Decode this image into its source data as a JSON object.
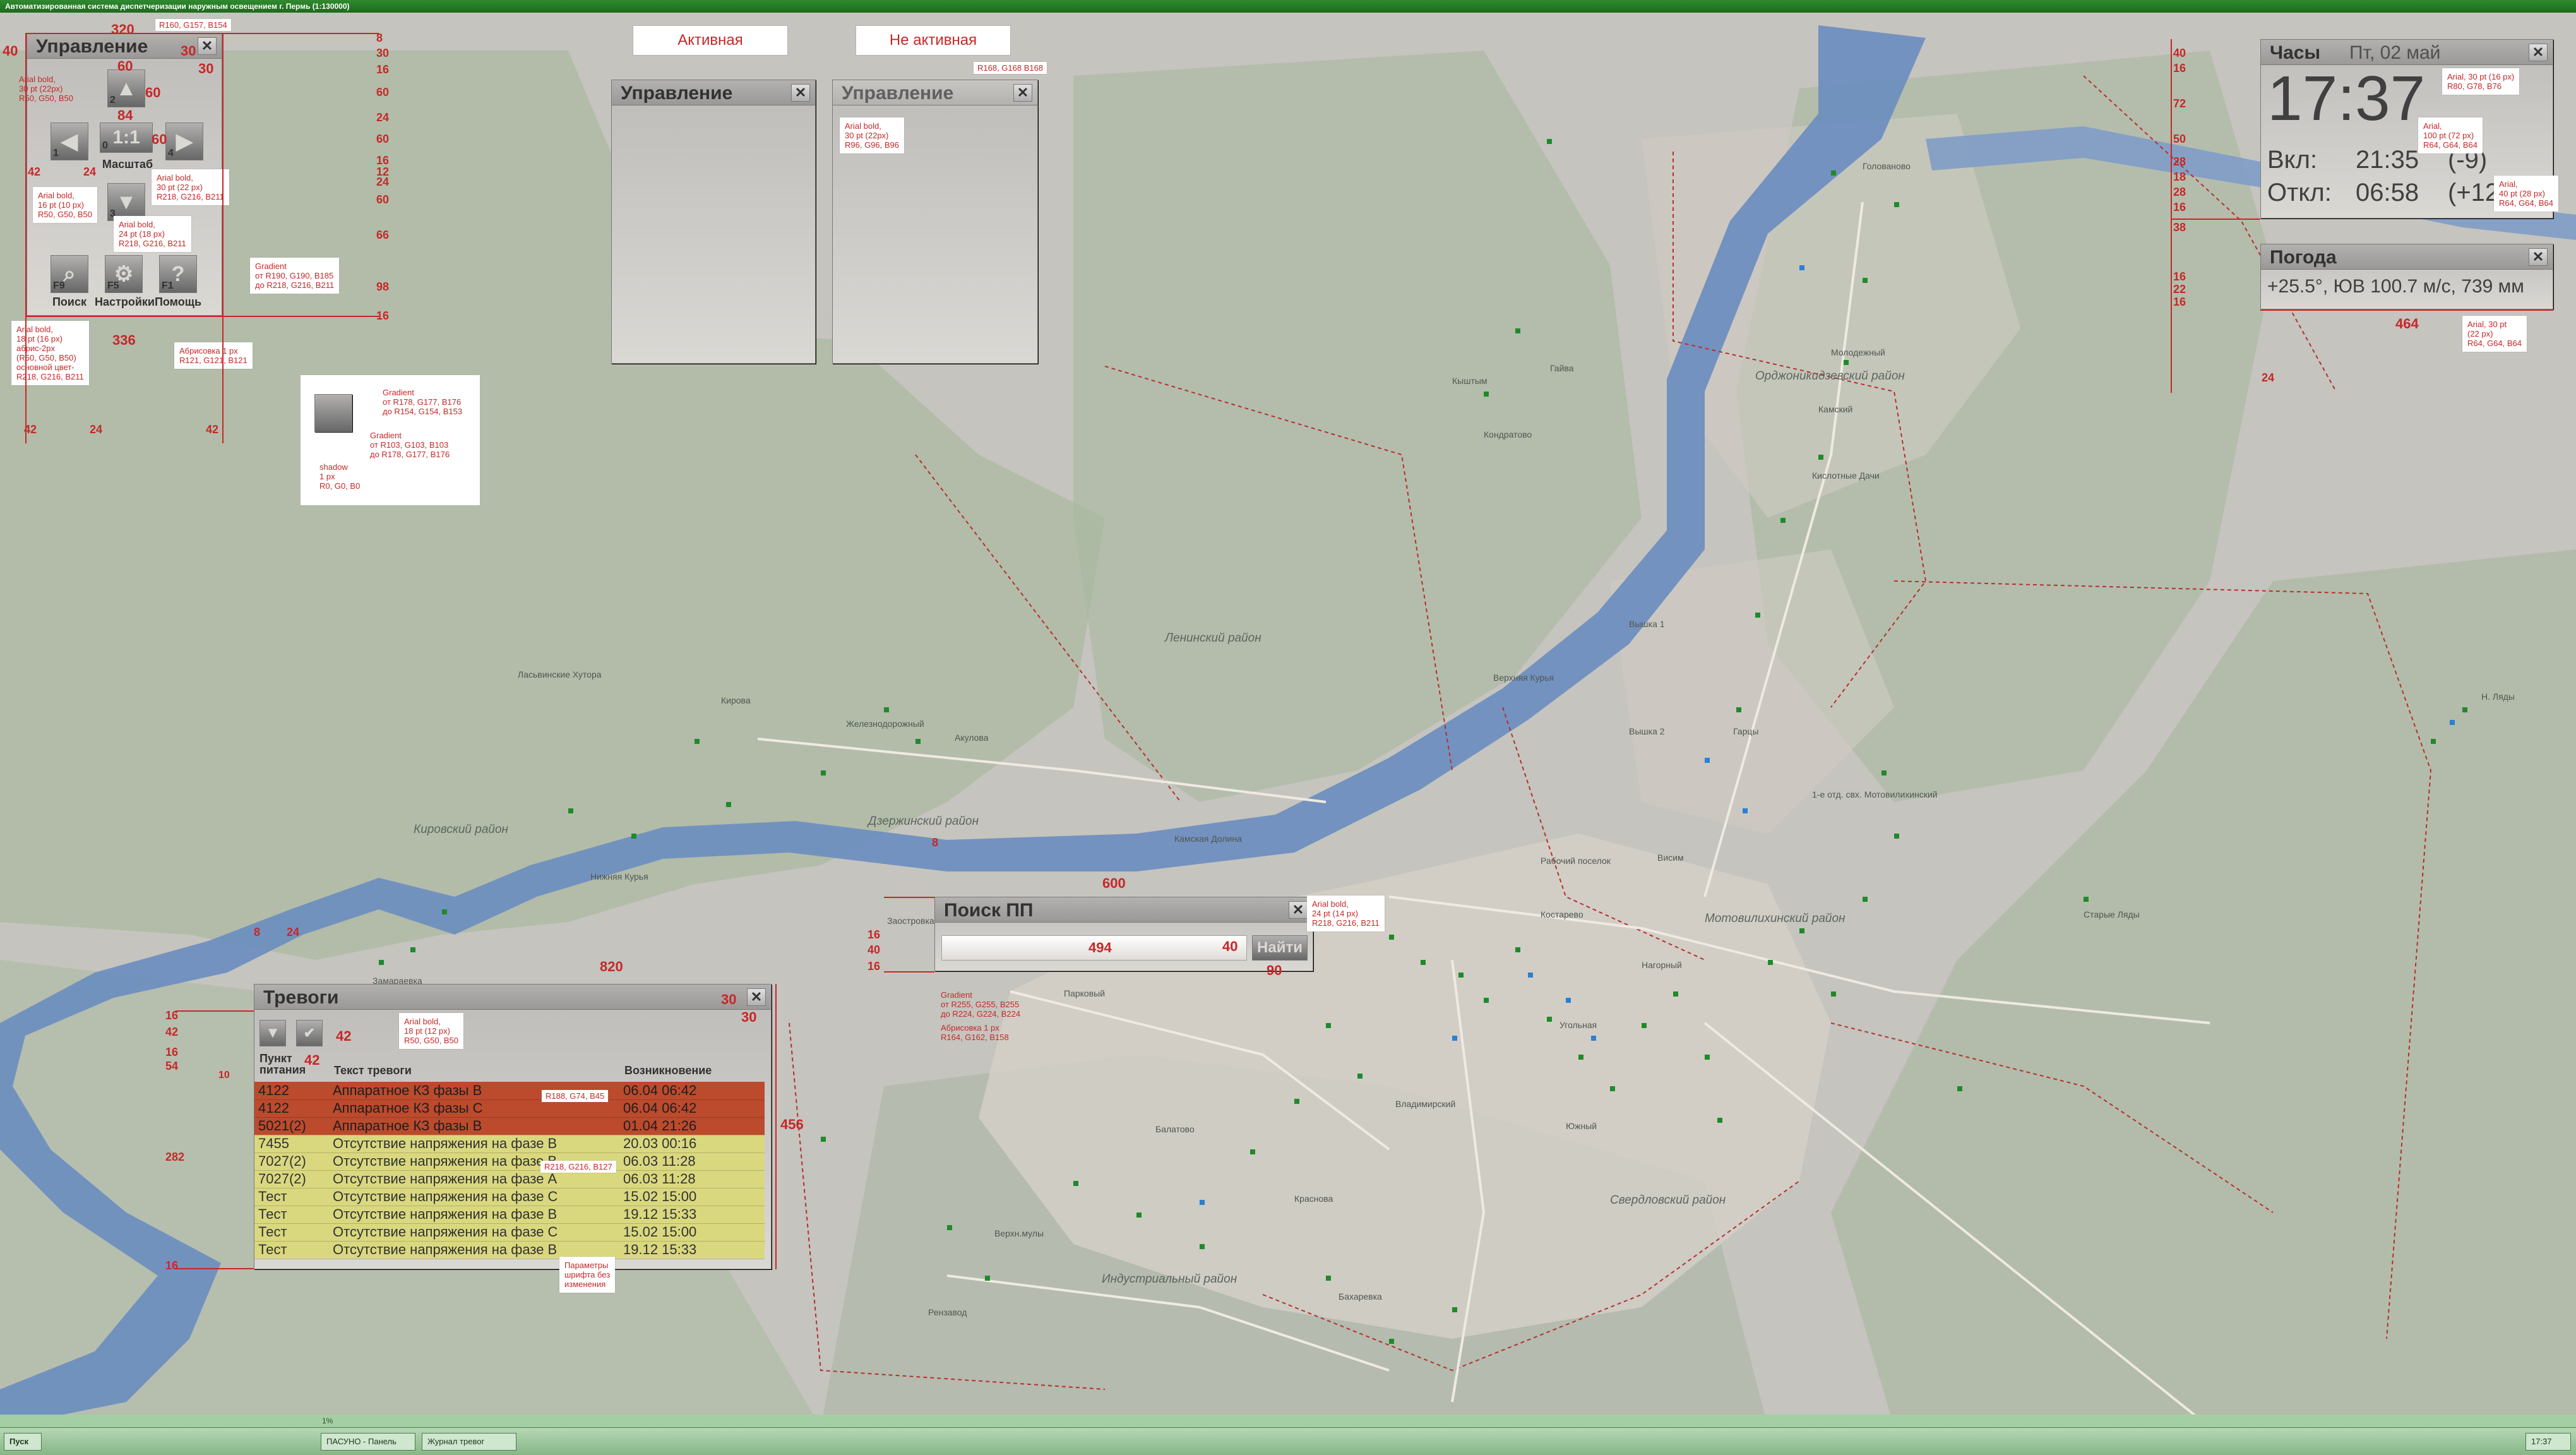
{
  "window": {
    "title": "Автоматизированная система диспетчеризации наружным освещением г. Пермь (1:130000)"
  },
  "colors": {
    "accent": "#c62828",
    "panel_text": "#323232",
    "alarm_red": "#bc4a2d",
    "alarm_yellow": "#dad87f"
  },
  "states": {
    "active": "Активная",
    "inactive": "Не активная"
  },
  "control": {
    "title": "Управление",
    "zoom_label": "Масштаб",
    "zoom_ratio": "1:1",
    "buttons": [
      {
        "name": "search",
        "label": "Поиск",
        "key": "F9",
        "icon": "magnifier-icon"
      },
      {
        "name": "settings",
        "label": "Настройки",
        "key": "F5",
        "icon": "gear-icon"
      },
      {
        "name": "help",
        "label": "Помощь",
        "key": "F1",
        "icon": "question-icon"
      }
    ],
    "arrow_keys": [
      "1",
      "2",
      "3",
      "4",
      "0"
    ]
  },
  "control_active": {
    "title": "Управление"
  },
  "control_inactive": {
    "title": "Управление"
  },
  "clock": {
    "title": "Часы",
    "date": "Пт, 02 май",
    "time": "17:37",
    "on_label": "Вкл:",
    "on_time": "21:35",
    "on_offset": "(-9)",
    "off_label": "Откл:",
    "off_time": "06:58",
    "off_offset": "(+12)"
  },
  "weather": {
    "title": "Погода",
    "text": "+25.5°, ЮВ 100.7 м/с, 739 мм"
  },
  "search": {
    "title": "Поиск ПП",
    "value": "",
    "button": "Найти"
  },
  "alarms": {
    "title": "Тревоги",
    "columns": [
      "Пункт питания",
      "Текст тревоги",
      "Возникновение"
    ],
    "rows": [
      {
        "point": "4122",
        "text": "Аппаратное КЗ фазы В",
        "time": "06.04 06:42",
        "level": "red"
      },
      {
        "point": "4122",
        "text": "Аппаратное КЗ фазы С",
        "time": "06.04 06:42",
        "level": "red"
      },
      {
        "point": "5021(2)",
        "text": "Аппаратное КЗ фазы В",
        "time": "01.04 21:26",
        "level": "red"
      },
      {
        "point": "7455",
        "text": "Отсутствие напряжения на фазе В",
        "time": "20.03 00:16",
        "level": "yellow"
      },
      {
        "point": "7027(2)",
        "text": "Отсутствие напряжения на фазе В",
        "time": "06.03 11:28",
        "level": "yellow"
      },
      {
        "point": "7027(2)",
        "text": "Отсутствие напряжения на фазе А",
        "time": "06.03 11:28",
        "level": "yellow"
      },
      {
        "point": "Тест",
        "text": "Отсутствие напряжения на фазе С",
        "time": "15.02 15:00",
        "level": "yellow"
      },
      {
        "point": "Тест",
        "text": "Отсутствие напряжения на фазе В",
        "time": "19.12 15:33",
        "level": "yellow"
      },
      {
        "point": "Тест",
        "text": "Отсутствие напряжения на фазе С",
        "time": "15.02 15:00",
        "level": "yellow"
      },
      {
        "point": "Тест",
        "text": "Отсутствие напряжения на фазе В",
        "time": "19.12 15:33",
        "level": "yellow"
      }
    ]
  },
  "map_labels": {
    "leninsky": "Ленинский район",
    "dzerzhinsky": "Дзержинский район",
    "kirovsky": "Кировский район",
    "motovilikhinsky": "Мотовилихинский район",
    "ordzhonikidzevsky": "Орджоникидзевский район",
    "sverdlovsky": "Свердловский район",
    "industrialny": "Индустриальный район",
    "kirova": "Кирова",
    "zheleznodorozhny": "Железнодорожный",
    "akulova": "Акулова",
    "lasvinskie": "Ласьвинские Хутора",
    "zaostrovka": "Заостровка",
    "kamennaya": "Камская Долина",
    "parkovy": "Парковый",
    "balatovo": "Балатово",
    "krasnova": "Краснова",
    "bakharevka": "Бахаревка",
    "rabochy": "Рабочий поселок",
    "vodoprovodnaya": "1-е отд. свх. Мотовилихинский",
    "vereshchagino": "Верхн.мулы",
    "gayva": "Гайва",
    "kamskiy": "Камский",
    "golovanovo": "Голованово",
    "molodezhny": "Молодежный",
    "kyshtym": "Кыштым",
    "nizhnyaya_kurya": "Нижняя Курья",
    "verkhnyaya_kurya": "Верхняя Курья",
    "rezinskiy": "Рензавод",
    "zamarayka": "Замараевка",
    "novyye_lyady": "Н. Ляды",
    "yuzhny": "Южный",
    "vladimirsky": "Владимирский",
    "garcy": "Гарцы",
    "kislotnye": "Кислотные Дачи",
    "kondratovo": "Кондратово",
    "staroe": "Старые Ляды",
    "vyshka1": "Вышка 1",
    "vyshka2": "Вышка 2",
    "visim": "Висим",
    "kostarevo": "Костарево",
    "nagornyy": "Нагорный",
    "ugolnaya": "Угольная"
  },
  "annotations": {
    "a1": "R160, G157, B154",
    "a2": "Arial bold,\n30 pt (22px)\nR50, G50, B50",
    "a3": "Arial bold,\n16 pt (10 px)\nR50, G50, B50",
    "a4": "Arial bold,\n30 pt (22 px)\nR218, G216, B211",
    "a5": "Arial bold,\n24 pt (18 px)\nR218, G216, B211",
    "a6": "Gradient\nот R190, G190, B185\nдо R218, G216, B211",
    "a7": "Arial bold,\n18 pt (16 px)\nабрис-2px\n(R50, G50, B50)\nосновной цвет-\nR218, G216, B211",
    "a8": "Абрисовка 1 px\nR121, G121, B121",
    "a9": "Gradient\nот R178, G177, B176\nдо R154, G154, B153",
    "a10": "Gradient\nот R103, G103, B103\nдо R178, G177, B176",
    "a11": "shadow\n1 px\nR0, G0, B0",
    "a12": "R168, G168 B168",
    "a13": "Arial bold,\n30 pt (22px)\nR96, G96, B96",
    "a14": "Arial bold,\n24 pt (14 px)\nR218, G216, B211",
    "a15": "Gradient\nот R255, G255, B255\nдо R224, G224, B224",
    "a16": "Абрисовка 1 px\nR164, G162, B158",
    "a17": "Arial bold,\n18 pt (12 px)\nR50, G50, B50",
    "a18": "R188, G74, B45",
    "a19": "R218, G216, B127",
    "a20": "Параметры\nшрифта без\nизменения",
    "a21": "Arial, 30 pt (16 px)\nR80, G78, B76",
    "a22": "Arial,\n100 pt (72 px)\nR64, G64, B64",
    "a23": "Arial,\n40 pt (28 px)\nR64, G64, B64",
    "a24": "Arial, 30 pt\n(22 px)\nR64, G64, B64"
  },
  "dims": {
    "d320": "320",
    "d60": "60",
    "d30": "30",
    "d40": "40",
    "d84": "84",
    "d42": "42",
    "d24": "24",
    "d336": "336",
    "d8": "8",
    "d16": "16",
    "d54": "54",
    "d10": "10",
    "d282": "282",
    "d820": "820",
    "d456": "456",
    "d600": "600",
    "d494": "494",
    "d90": "90",
    "d464": "464",
    "d66": "66",
    "d98": "98",
    "d20": "20",
    "d12": "12",
    "d50": "50",
    "d28": "28",
    "d18": "18",
    "d38": "38",
    "d22": "22"
  },
  "status": {
    "zoom_text": "1%"
  },
  "taskbar": {
    "start": "Пуск",
    "items": [
      "ПАСУНО - Панель",
      "Журнал тревог"
    ],
    "clock": "17:37"
  }
}
